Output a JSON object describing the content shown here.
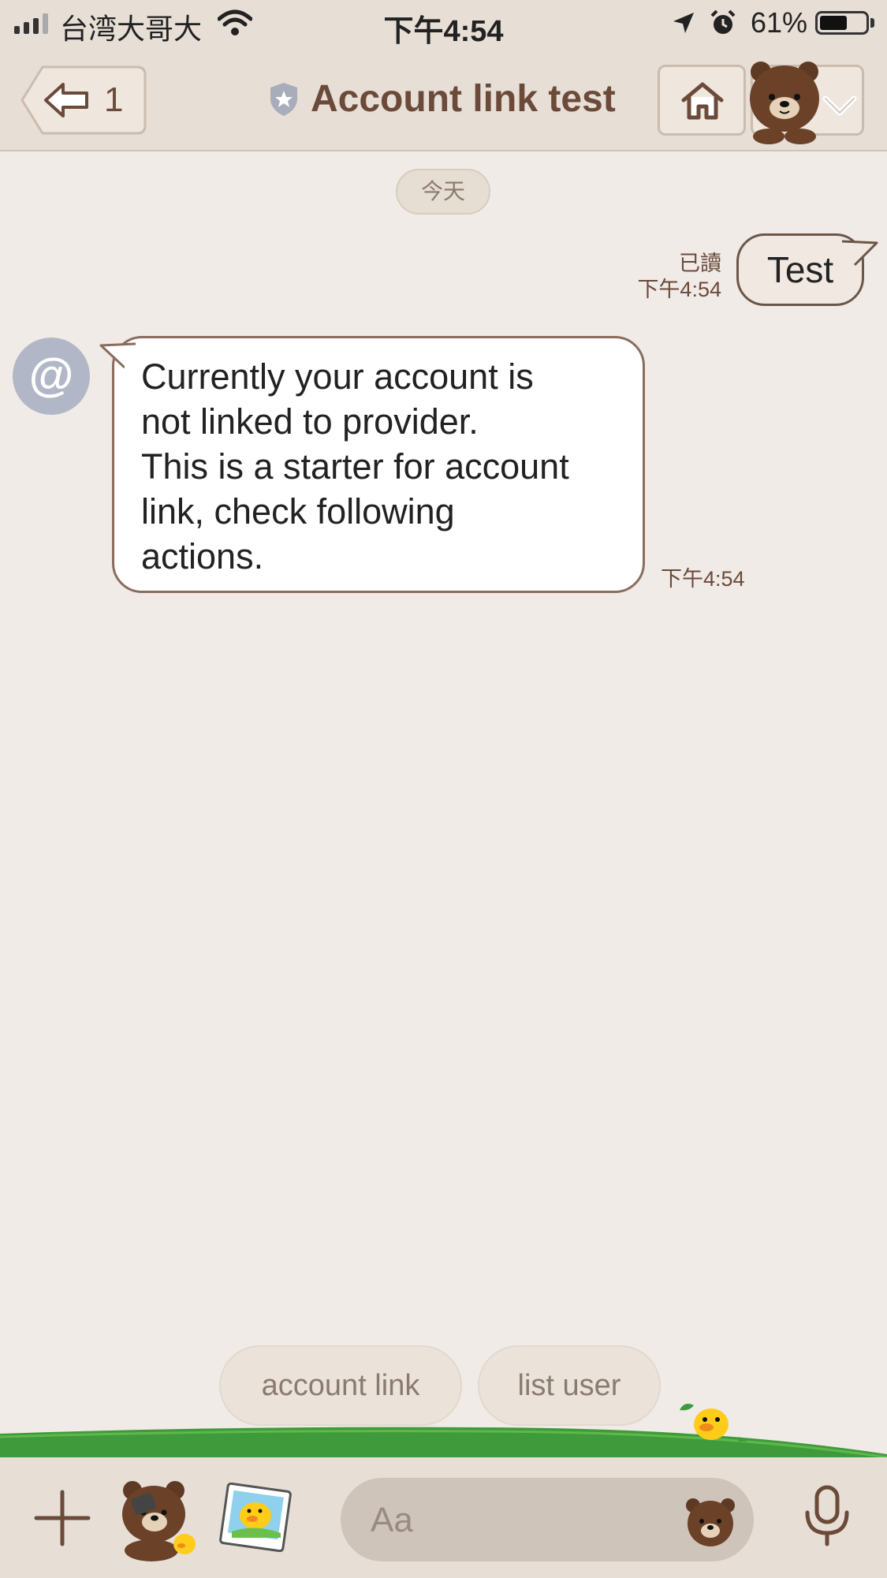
{
  "status_bar": {
    "carrier": "台湾大哥大",
    "time": "下午4:54",
    "battery_percent": "61%",
    "battery_level": 0.61,
    "signal_bars": 3
  },
  "header": {
    "back_count": "1",
    "title": "Account link test",
    "icons": [
      "back-arrow-icon",
      "official-badge-icon",
      "home-icon",
      "bear-avatar-icon",
      "chevron-down-icon"
    ]
  },
  "chat": {
    "date_divider": "今天",
    "messages": [
      {
        "direction": "outgoing",
        "read_status": "已讀",
        "time": "下午4:54",
        "text": "Test"
      },
      {
        "direction": "incoming",
        "avatar": "@",
        "time": "下午4:54",
        "lines": [
          "Currently your account is",
          "not linked to provider.",
          "This is a starter for account",
          "link, check following",
          "actions."
        ]
      }
    ]
  },
  "quick_replies": [
    "account link",
    "list user"
  ],
  "input_bar": {
    "placeholder": "Aa",
    "icons": [
      "plus-icon",
      "bear-sticker-icon",
      "sally-photo-icon",
      "bear-emoji-icon",
      "microphone-icon"
    ]
  },
  "colors": {
    "background": "#f0ebe6",
    "header": "#e7ded6",
    "brown_text": "#6b4a3a",
    "avatar": "#b1b7c7",
    "grass": "#3f9a3c"
  }
}
